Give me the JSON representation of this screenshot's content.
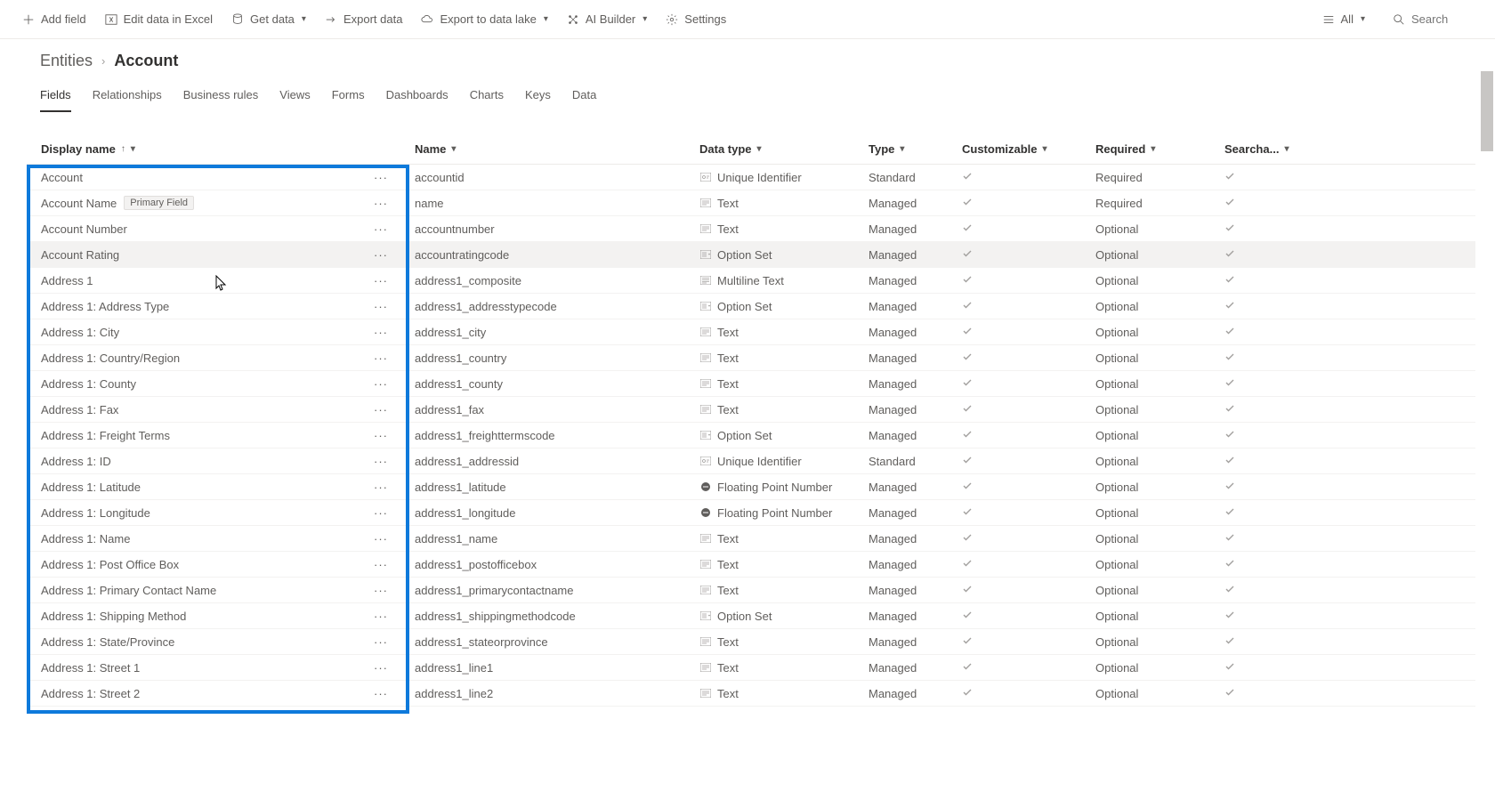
{
  "commands": {
    "add_field": "Add field",
    "edit_excel": "Edit data in Excel",
    "get_data": "Get data",
    "export_data": "Export data",
    "export_lake": "Export to data lake",
    "ai_builder": "AI Builder",
    "settings": "Settings",
    "all_filter": "All",
    "search_placeholder": "Search"
  },
  "breadcrumb": {
    "parent": "Entities",
    "current": "Account"
  },
  "tabs": [
    {
      "label": "Fields",
      "active": true
    },
    {
      "label": "Relationships",
      "active": false
    },
    {
      "label": "Business rules",
      "active": false
    },
    {
      "label": "Views",
      "active": false
    },
    {
      "label": "Forms",
      "active": false
    },
    {
      "label": "Dashboards",
      "active": false
    },
    {
      "label": "Charts",
      "active": false
    },
    {
      "label": "Keys",
      "active": false
    },
    {
      "label": "Data",
      "active": false
    }
  ],
  "columns": {
    "display_name": "Display name",
    "name": "Name",
    "data_type": "Data type",
    "type": "Type",
    "customizable": "Customizable",
    "required": "Required",
    "searchable": "Searcha..."
  },
  "primary_badge": "Primary Field",
  "rows": [
    {
      "display": "Account",
      "primary": false,
      "name": "accountid",
      "datatype": "Unique Identifier",
      "dticon": "id",
      "type": "Standard",
      "customizable": true,
      "required": "Required",
      "searchable": true,
      "hovered": false
    },
    {
      "display": "Account Name",
      "primary": true,
      "name": "name",
      "datatype": "Text",
      "dticon": "text",
      "type": "Managed",
      "customizable": true,
      "required": "Required",
      "searchable": true,
      "hovered": false
    },
    {
      "display": "Account Number",
      "primary": false,
      "name": "accountnumber",
      "datatype": "Text",
      "dticon": "text",
      "type": "Managed",
      "customizable": true,
      "required": "Optional",
      "searchable": true,
      "hovered": false
    },
    {
      "display": "Account Rating",
      "primary": false,
      "name": "accountratingcode",
      "datatype": "Option Set",
      "dticon": "option",
      "type": "Managed",
      "customizable": true,
      "required": "Optional",
      "searchable": true,
      "hovered": true
    },
    {
      "display": "Address 1",
      "primary": false,
      "name": "address1_composite",
      "datatype": "Multiline Text",
      "dticon": "multi",
      "type": "Managed",
      "customizable": true,
      "required": "Optional",
      "searchable": true,
      "hovered": false
    },
    {
      "display": "Address 1: Address Type",
      "primary": false,
      "name": "address1_addresstypecode",
      "datatype": "Option Set",
      "dticon": "option",
      "type": "Managed",
      "customizable": true,
      "required": "Optional",
      "searchable": true,
      "hovered": false
    },
    {
      "display": "Address 1: City",
      "primary": false,
      "name": "address1_city",
      "datatype": "Text",
      "dticon": "text",
      "type": "Managed",
      "customizable": true,
      "required": "Optional",
      "searchable": true,
      "hovered": false
    },
    {
      "display": "Address 1: Country/Region",
      "primary": false,
      "name": "address1_country",
      "datatype": "Text",
      "dticon": "text",
      "type": "Managed",
      "customizable": true,
      "required": "Optional",
      "searchable": true,
      "hovered": false
    },
    {
      "display": "Address 1: County",
      "primary": false,
      "name": "address1_county",
      "datatype": "Text",
      "dticon": "text",
      "type": "Managed",
      "customizable": true,
      "required": "Optional",
      "searchable": true,
      "hovered": false
    },
    {
      "display": "Address 1: Fax",
      "primary": false,
      "name": "address1_fax",
      "datatype": "Text",
      "dticon": "text",
      "type": "Managed",
      "customizable": true,
      "required": "Optional",
      "searchable": true,
      "hovered": false
    },
    {
      "display": "Address 1: Freight Terms",
      "primary": false,
      "name": "address1_freighttermscode",
      "datatype": "Option Set",
      "dticon": "option",
      "type": "Managed",
      "customizable": true,
      "required": "Optional",
      "searchable": true,
      "hovered": false
    },
    {
      "display": "Address 1: ID",
      "primary": false,
      "name": "address1_addressid",
      "datatype": "Unique Identifier",
      "dticon": "id",
      "type": "Standard",
      "customizable": true,
      "required": "Optional",
      "searchable": true,
      "hovered": false
    },
    {
      "display": "Address 1: Latitude",
      "primary": false,
      "name": "address1_latitude",
      "datatype": "Floating Point Number",
      "dticon": "float",
      "type": "Managed",
      "customizable": true,
      "required": "Optional",
      "searchable": true,
      "hovered": false
    },
    {
      "display": "Address 1: Longitude",
      "primary": false,
      "name": "address1_longitude",
      "datatype": "Floating Point Number",
      "dticon": "float",
      "type": "Managed",
      "customizable": true,
      "required": "Optional",
      "searchable": true,
      "hovered": false
    },
    {
      "display": "Address 1: Name",
      "primary": false,
      "name": "address1_name",
      "datatype": "Text",
      "dticon": "text",
      "type": "Managed",
      "customizable": true,
      "required": "Optional",
      "searchable": true,
      "hovered": false
    },
    {
      "display": "Address 1: Post Office Box",
      "primary": false,
      "name": "address1_postofficebox",
      "datatype": "Text",
      "dticon": "text",
      "type": "Managed",
      "customizable": true,
      "required": "Optional",
      "searchable": true,
      "hovered": false
    },
    {
      "display": "Address 1: Primary Contact Name",
      "primary": false,
      "name": "address1_primarycontactname",
      "datatype": "Text",
      "dticon": "text",
      "type": "Managed",
      "customizable": true,
      "required": "Optional",
      "searchable": true,
      "hovered": false
    },
    {
      "display": "Address 1: Shipping Method",
      "primary": false,
      "name": "address1_shippingmethodcode",
      "datatype": "Option Set",
      "dticon": "option",
      "type": "Managed",
      "customizable": true,
      "required": "Optional",
      "searchable": true,
      "hovered": false
    },
    {
      "display": "Address 1: State/Province",
      "primary": false,
      "name": "address1_stateorprovince",
      "datatype": "Text",
      "dticon": "text",
      "type": "Managed",
      "customizable": true,
      "required": "Optional",
      "searchable": true,
      "hovered": false
    },
    {
      "display": "Address 1: Street 1",
      "primary": false,
      "name": "address1_line1",
      "datatype": "Text",
      "dticon": "text",
      "type": "Managed",
      "customizable": true,
      "required": "Optional",
      "searchable": true,
      "hovered": false
    },
    {
      "display": "Address 1: Street 2",
      "primary": false,
      "name": "address1_line2",
      "datatype": "Text",
      "dticon": "text",
      "type": "Managed",
      "customizable": true,
      "required": "Optional",
      "searchable": true,
      "hovered": false
    }
  ]
}
